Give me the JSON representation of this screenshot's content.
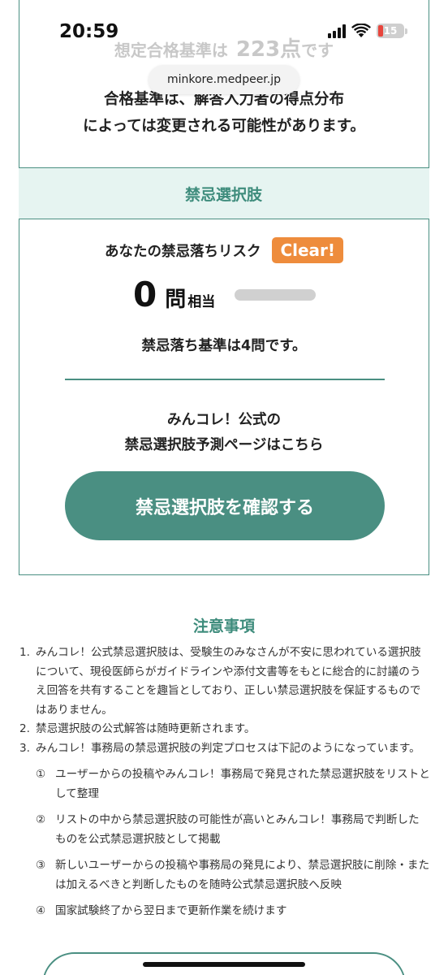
{
  "status_bar": {
    "time": "20:59",
    "battery_level": "15",
    "battery_color": "#e8453c"
  },
  "browser": {
    "url": "minkore.medpeer.jp"
  },
  "score": {
    "label": "想定合格基準は",
    "value": "223点",
    "suffix": "です"
  },
  "pass_note": {
    "line1": "合格基準は、解答入力者の得点分布",
    "line2": "によっては変更される可能性があります。"
  },
  "contraindication": {
    "section_title": "禁忌選択肢",
    "risk_label": "あなたの禁忌落ちリスク",
    "risk_badge": "Clear!",
    "count": "0",
    "count_unit": "問",
    "count_suffix": "相当",
    "risk_level": 0,
    "criteria": "禁忌落ち基準は4問です。",
    "link_line1": "みんコレ！公式の",
    "link_line2": "禁忌選択肢予測ページはこちら",
    "button_label": "禁忌選択肢を確認する"
  },
  "notes": {
    "title": "注意事項",
    "items": [
      {
        "num": "1.",
        "text": "みんコレ！公式禁忌選択肢は、受験生のみなさんが不安に思われている選択肢について、現役医師らがガイドラインや添付文書等をもとに総合的に討議のうえ回答を共有することを趣旨としており、正しい禁忌選択肢を保証するものではありません。"
      },
      {
        "num": "2.",
        "text": "禁忌選択肢の公式解答は随時更新されます。"
      },
      {
        "num": "3.",
        "text": "みんコレ！事務局の禁忌選択肢の判定プロセスは下記のようになっています。"
      }
    ],
    "sub_items": [
      {
        "num": "①",
        "text": "ユーザーからの投稿やみんコレ！事務局で発見された禁忌選択肢をリストとして整理"
      },
      {
        "num": "②",
        "text": "リストの中から禁忌選択肢の可能性が高いとみんコレ！事務局で判断したものを公式禁忌選択肢として掲載"
      },
      {
        "num": "③",
        "text": "新しいユーザーからの投稿や事務局の発見により、禁忌選択肢に削除・または加えるべきと判断したものを随時公式禁忌選択肢へ反映"
      },
      {
        "num": "④",
        "text": "国家試験終了から翌日まで更新作業を続けます"
      }
    ]
  },
  "colors": {
    "accent": "#4a8f82",
    "accent_light": "#e6f4f1",
    "badge": "#ee8c3c"
  }
}
